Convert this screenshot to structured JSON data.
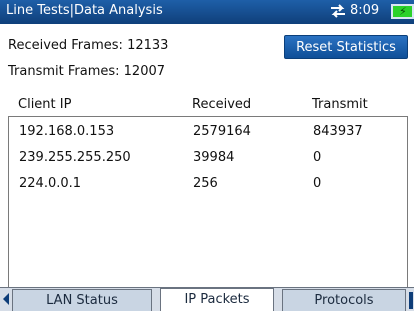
{
  "header": {
    "title": "Line Tests|Data Analysis",
    "time": "8:09",
    "sync_icon": "sync-arrows-icon",
    "battery_icon": "battery-charging-icon"
  },
  "stats": {
    "received_frames": "Received Frames:  12133",
    "transmit_frames": "Transmit Frames:  12007",
    "reset_label": "Reset Statistics"
  },
  "table": {
    "columns": [
      "Client IP",
      "Received",
      "Transmit"
    ],
    "rows": [
      {
        "ip": "192.168.0.153",
        "received": "2579164",
        "transmit": "843937"
      },
      {
        "ip": "239.255.255.250",
        "received": "39984",
        "transmit": "0"
      },
      {
        "ip": "224.0.0.1",
        "received": "256",
        "transmit": "0"
      }
    ]
  },
  "tabs": [
    {
      "label": "LAN Status"
    },
    {
      "label": "IP Packets"
    },
    {
      "label": "Protocols"
    }
  ],
  "colors": {
    "title_bar": "#1e5fa8",
    "accent_button": "#1f63b0",
    "battery": "#2bd12b"
  }
}
